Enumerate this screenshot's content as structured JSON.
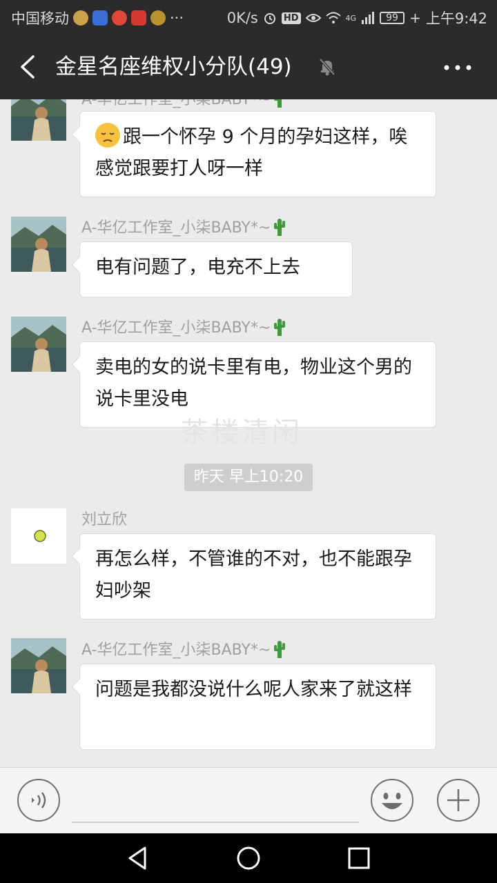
{
  "status_bar": {
    "carrier": "中国移动",
    "overflow": "···",
    "net_speed": "0K/s",
    "hd": "HD",
    "signal_type": "4G",
    "battery": "99",
    "time": "上午9:42"
  },
  "title_bar": {
    "title": "金星名座维权小分队(49)"
  },
  "messages": [
    {
      "sender": "A-华亿工作室_小柒BABY*~",
      "text": "跟一个怀孕 9 个月的孕妇这样，唉感觉跟要打人呀一样",
      "emoji": "pensive-face"
    },
    {
      "sender": "A-华亿工作室_小柒BABY*~",
      "text": "电有问题了，电充不上去"
    },
    {
      "sender": "A-华亿工作室_小柒BABY*~",
      "text": "卖电的女的说卡里有电，物业这个男的说卡里没电"
    },
    {
      "sender": "刘立欣",
      "text": "再怎么样，不管谁的不对，也不能跟孕妇吵架"
    },
    {
      "sender": "A-华亿工作室_小柒BABY*~",
      "text": "问题是我都没说什么呢人家来了就这样"
    }
  ],
  "time_separator": "昨天 早上10:20",
  "watermark": "茶楼清闲",
  "colors": {
    "title_bar": "#2b2b2b",
    "chat_bg": "#ebebeb",
    "bubble": "#ffffff",
    "sender_name": "#a0a0a0"
  },
  "icons": {
    "back": "chevron-left-icon",
    "mute": "bell-off-icon",
    "more": "more-dots-icon",
    "voice": "voice-icon",
    "emoji": "emoji-icon",
    "add": "plus-icon"
  }
}
